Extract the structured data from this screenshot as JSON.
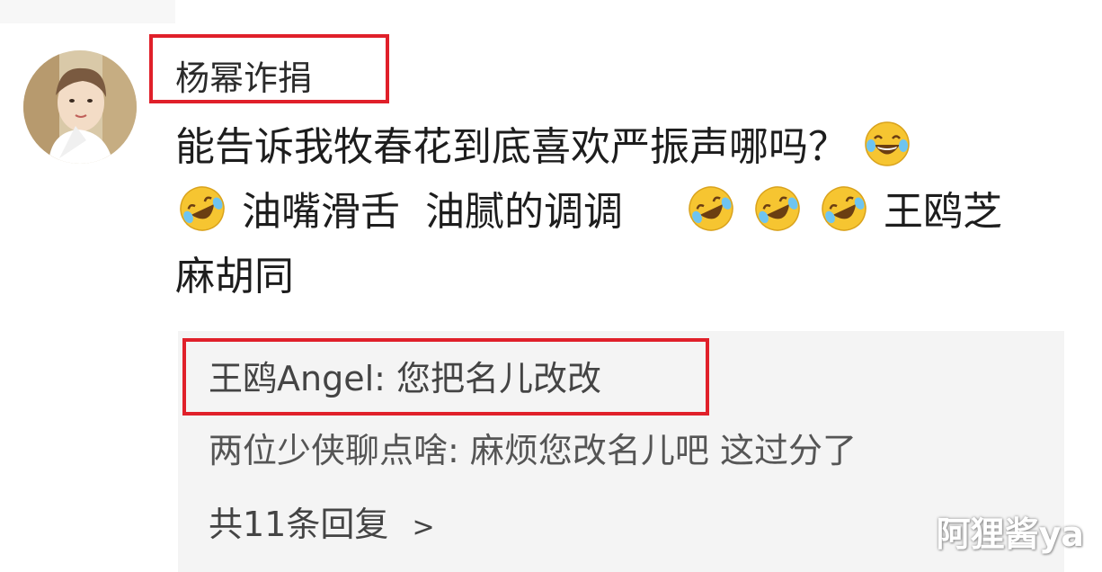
{
  "comment": {
    "username": "杨幂诈捐",
    "line1_text": "能告诉我牧春花到底喜欢严振声哪吗？",
    "line2_text_a": "油嘴滑舌  油腻的调调",
    "line2_text_b": "王鸥芝",
    "line3_text": "麻胡同",
    "emoji_name": "laughing-crying-emoji"
  },
  "replies": {
    "reply1": "王鸥Angel: 您把名儿改改",
    "reply2": "两位少侠聊点啥: 麻烦您改名儿吧 这过分了",
    "more_label": "共11条回复",
    "more_chevron": ">"
  },
  "watermark": "阿狸酱ya",
  "colors": {
    "highlight_box": "#e0202a",
    "reply_background": "#f4f4f4",
    "emoji_face": "#f6c531"
  }
}
